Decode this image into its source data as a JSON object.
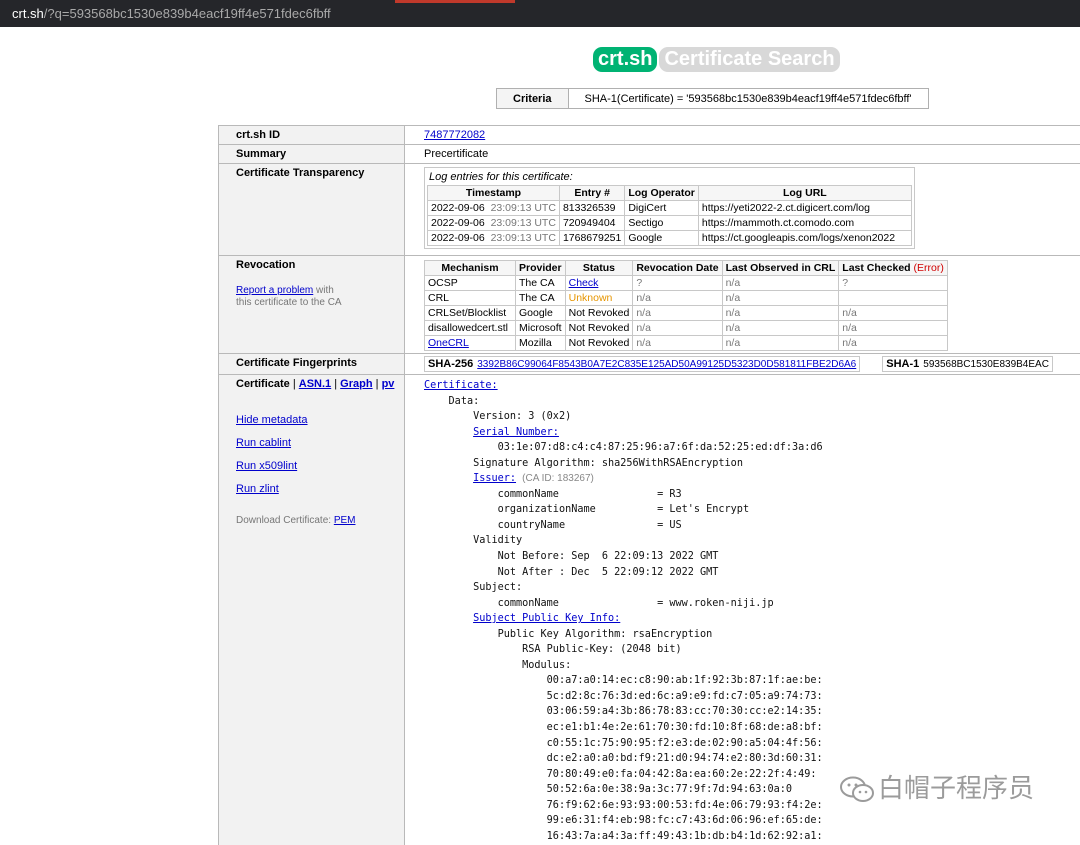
{
  "browser": {
    "url_host": "crt.sh",
    "url_path": "/?q=593568bc1530e839b4eacf19ff4e571fdec6fbff"
  },
  "header": {
    "logo": "crt.sh",
    "subtitle": "Certificate Search"
  },
  "criteria": {
    "label": "Criteria",
    "value": "SHA-1(Certificate) = '593568bc1530e839b4eacf19ff4e571fdec6fbff'"
  },
  "rows": {
    "id": {
      "label": "crt.sh ID",
      "value": "7487772082"
    },
    "summary": {
      "label": "Summary",
      "value": "Precertificate"
    },
    "ct": {
      "label": "Certificate Transparency",
      "caption": "Log entries for this certificate:",
      "headers": [
        "Timestamp",
        "Entry #",
        "Log Operator",
        "Log URL"
      ],
      "entries": [
        {
          "date": "2022-09-06",
          "time": "23:09:13 UTC",
          "entry": "813326539",
          "operator": "DigiCert",
          "url": "https://yeti2022-2.ct.digicert.com/log"
        },
        {
          "date": "2022-09-06",
          "time": "23:09:13 UTC",
          "entry": "720949404",
          "operator": "Sectigo",
          "url": "https://mammoth.ct.comodo.com"
        },
        {
          "date": "2022-09-06",
          "time": "23:09:13 UTC",
          "entry": "1768679251",
          "operator": "Google",
          "url": "https://ct.googleapis.com/logs/xenon2022"
        }
      ]
    },
    "revocation": {
      "label": "Revocation",
      "report_link": "Report a problem",
      "report_with": " with",
      "report_tail": "this certificate to the CA",
      "headers": [
        "Mechanism",
        "Provider",
        "Status",
        "Revocation Date",
        "Last Observed in CRL",
        "Last Checked"
      ],
      "error_label": "(Error)",
      "rows": [
        {
          "mechanism": "OCSP",
          "provider": "The CA",
          "status": "Check",
          "date": "?",
          "observed": "n/a",
          "checked": "?"
        },
        {
          "mechanism": "CRL",
          "provider": "The CA",
          "status": "Unknown",
          "date": "n/a",
          "observed": "n/a",
          "checked": ""
        },
        {
          "mechanism": "CRLSet/Blocklist",
          "provider": "Google",
          "status": "Not Revoked",
          "date": "n/a",
          "observed": "n/a",
          "checked": "n/a"
        },
        {
          "mechanism": "disallowedcert.stl",
          "provider": "Microsoft",
          "status": "Not Revoked",
          "date": "n/a",
          "observed": "n/a",
          "checked": "n/a"
        },
        {
          "mechanism": "OneCRL",
          "provider": "Mozilla",
          "status": "Not Revoked",
          "date": "n/a",
          "observed": "n/a",
          "checked": "n/a"
        }
      ]
    },
    "fingerprints": {
      "label": "Certificate Fingerprints",
      "sha256_label": "SHA-256",
      "sha256": "3392B86C99064F8543B0A7E2C835E125AD50A99125D5323D0D581811FBE2D6A6",
      "sha1_label": "SHA-1",
      "sha1": "593568BC1530E839B4EAC"
    },
    "certificate": {
      "label": "Certificate",
      "views": [
        "ASN.1",
        "Graph",
        "pv"
      ],
      "sep": "|",
      "links": [
        "Hide metadata",
        "Run cablint",
        "Run x509lint",
        "Run zlint"
      ],
      "download_label": "Download Certificate:",
      "download_link": "PEM"
    }
  },
  "cert_text": {
    "certificate": "Certificate:",
    "data": "Data:",
    "version": "Version: 3 (0x2)",
    "serial_label": "Serial Number:",
    "serial": "03:1e:07:d8:c4:c4:87:25:96:a7:6f:da:52:25:ed:df:3a:d6",
    "sig_alg": "Signature Algorithm: sha256WithRSAEncryption",
    "issuer_label": "Issuer:",
    "issuer_ca_id": "(CA ID: 183267)",
    "issuer_cn": "commonName                = R3",
    "issuer_o": "organizationName          = Let's Encrypt",
    "issuer_c": "countryName               = US",
    "validity": "Validity",
    "not_before": "Not Before: Sep  6 22:09:13 2022 GMT",
    "not_after": "Not After : Dec  5 22:09:12 2022 GMT",
    "subject": "Subject:",
    "subject_cn": "commonName                = www.roken-niji.jp",
    "spki_label": "Subject Public Key Info:",
    "pk_alg": "Public Key Algorithm: rsaEncryption",
    "rsa_key": "RSA Public-Key: (2048 bit)",
    "modulus": "Modulus:",
    "modulus_lines": [
      "00:a7:a0:14:ec:c8:90:ab:1f:92:3b:87:1f:ae:be:",
      "5c:d2:8c:76:3d:ed:6c:a9:e9:fd:c7:05:a9:74:73:",
      "03:06:59:a4:3b:86:78:83:cc:70:30:cc:e2:14:35:",
      "ec:e1:b1:4e:2e:61:70:30:fd:10:8f:68:de:a8:bf:",
      "c0:55:1c:75:90:95:f2:e3:de:02:90:a5:04:4f:56:",
      "dc:e2:a0:a0:bd:f9:21:d0:94:74:e2:80:3d:60:31:",
      "70:80:49:e0:fa:04:42:8a:ea:60:2e:22:2f:4:49:",
      "50:52:6a:0e:38:9a:3c:77:9f:7d:94:63:0a:0",
      "76:f9:62:6e:93:93:00:53:fd:4e:06:79:93:f4:2e:",
      "99:e6:31:f4:eb:98:fc:c7:43:6d:06:96:ef:65:de:",
      "16:43:7a:a4:3a:ff:49:43:1b:db:b4:1d:62:92:a1:"
    ]
  },
  "watermark": {
    "text": "白帽子程序员"
  }
}
